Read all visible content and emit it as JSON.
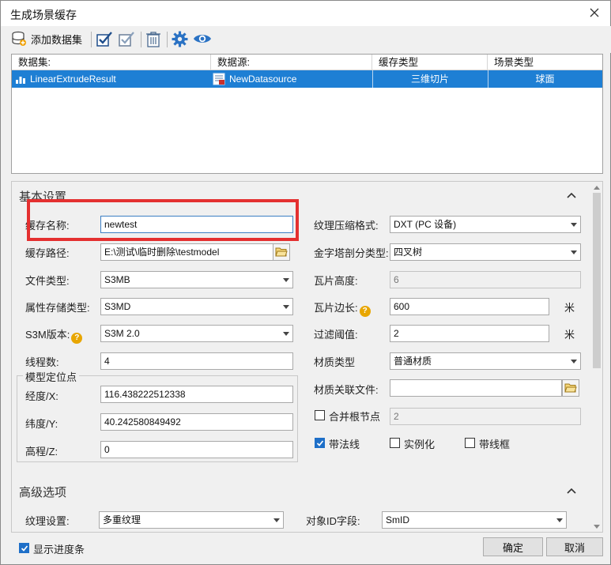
{
  "window": {
    "title": "生成场景缓存"
  },
  "toolbar": {
    "add_dataset_label": "添加数据集"
  },
  "table": {
    "headers": [
      "数据集:",
      "数据源:",
      "缓存类型",
      "场景类型"
    ],
    "rows": [
      {
        "dataset": "LinearExtrudeResult",
        "datasource": "NewDatasource",
        "cache_type": "三维切片",
        "scene_type": "球面"
      }
    ]
  },
  "basic": {
    "section_title": "基本设置",
    "cache_name_label": "缓存名称:",
    "cache_name_value": "newtest",
    "cache_path_label": "缓存路径:",
    "cache_path_value": "E:\\测试\\临时删除\\testmodel",
    "file_type_label": "文件类型:",
    "file_type_value": "S3MB",
    "attr_storage_label": "属性存储类型:",
    "attr_storage_value": "S3MD",
    "s3m_version_label": "S3M版本:",
    "s3m_version_value": "S3M 2.0",
    "threads_label": "线程数:",
    "threads_value": "4",
    "model_position_title": "模型定位点",
    "lon_label": "经度/X:",
    "lon_value": "116.438222512338",
    "lat_label": "纬度/Y:",
    "lat_value": "40.242580849492",
    "elev_label": "高程/Z:",
    "elev_value": "0",
    "texture_compress_label": "纹理压缩格式:",
    "texture_compress_value": "DXT (PC 设备)",
    "pyramid_label": "金字塔剖分类型:",
    "pyramid_value": "四叉树",
    "tile_height_label": "瓦片高度:",
    "tile_height_value": "6",
    "tile_side_label": "瓦片边长:",
    "tile_side_value": "600",
    "tile_side_unit": "米",
    "filter_label": "过滤阈值:",
    "filter_value": "2",
    "filter_unit": "米",
    "material_type_label": "材质类型",
    "material_type_value": "普通材质",
    "material_file_label": "材质关联文件:",
    "material_file_value": "",
    "merge_root_label": "合并根节点",
    "merge_root_value": "2",
    "normal_label": "带法线",
    "instance_label": "实例化",
    "wireframe_label": "带线框"
  },
  "advanced": {
    "section_title": "高级选项",
    "texture_setting_label": "纹理设置:",
    "texture_setting_value": "多重纹理",
    "object_id_label": "对象ID字段:",
    "object_id_value": "SmID"
  },
  "footer": {
    "show_progress_label": "显示进度条",
    "ok_label": "确定",
    "cancel_label": "取消"
  },
  "colors": {
    "selection": "#1e7fd4",
    "highlight": "#e43030",
    "check": "#1e6fc8"
  }
}
